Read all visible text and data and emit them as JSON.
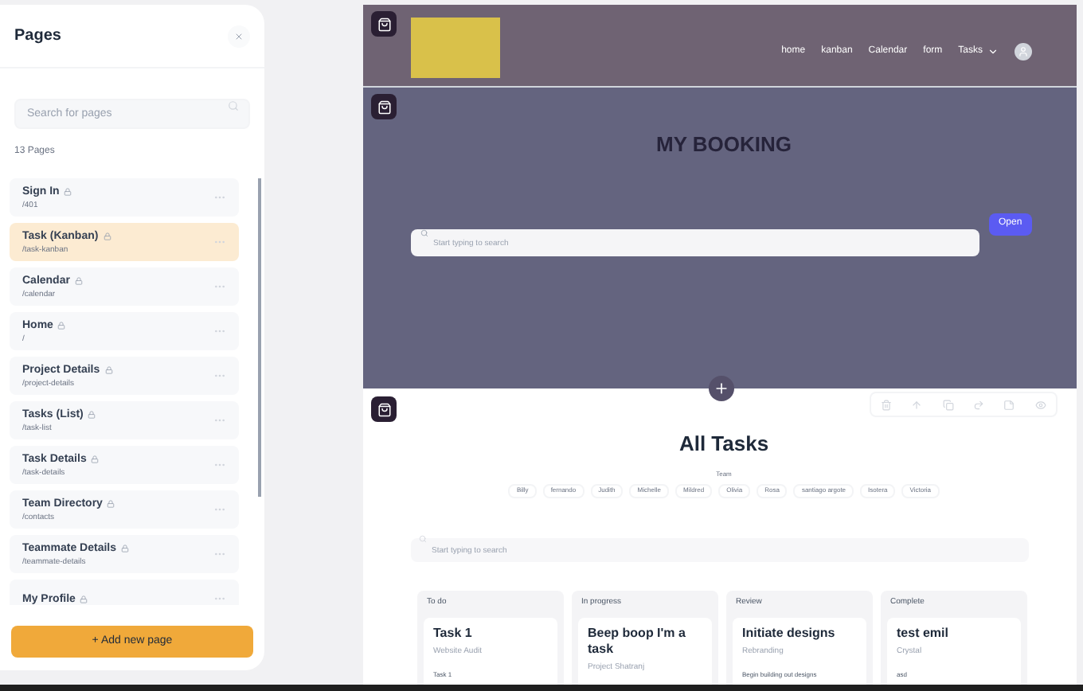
{
  "panel": {
    "title": "Pages",
    "search": {
      "placeholder": "Search for pages"
    },
    "count": "13 Pages",
    "pages": [
      {
        "name": "Sign In",
        "path": "/401",
        "selected": false
      },
      {
        "name": "Task (Kanban)",
        "path": "/task-kanban",
        "selected": true
      },
      {
        "name": "Calendar",
        "path": "/calendar",
        "selected": false
      },
      {
        "name": "Home",
        "path": "/",
        "selected": false
      },
      {
        "name": "Project Details",
        "path": "/project-details",
        "selected": false
      },
      {
        "name": "Tasks (List)",
        "path": "/task-list",
        "selected": false
      },
      {
        "name": "Task Details",
        "path": "/task-details",
        "selected": false
      },
      {
        "name": "Team Directory",
        "path": "/contacts",
        "selected": false
      },
      {
        "name": "Teammate Details",
        "path": "/teammate-details",
        "selected": false
      },
      {
        "name": "My Profile",
        "selected": false
      }
    ],
    "add_button": "+ Add new page"
  },
  "header": {
    "nav": [
      {
        "label": "home",
        "kind": "link"
      },
      {
        "label": "kanban",
        "kind": "link"
      },
      {
        "label": "Calendar",
        "kind": "link"
      },
      {
        "label": "form",
        "kind": "link"
      },
      {
        "label": "Tasks",
        "kind": "dropdown"
      }
    ]
  },
  "booking": {
    "title": "MY BOOKING",
    "search": {
      "placeholder": "Start typing to search"
    },
    "button": "Open"
  },
  "tasks": {
    "title": "All Tasks",
    "team_label": "Team",
    "team": [
      "Billy",
      "fernando",
      "Judith",
      "Michelle",
      "Mildred",
      "Olivia",
      "Rosa",
      "santiago argote",
      "Isotera",
      "Victoria"
    ],
    "search": {
      "placeholder": "Start typing to search"
    },
    "columns": [
      {
        "title": "To do",
        "card": {
          "title": "Task 1",
          "project": "Website Audit",
          "description": "Task 1"
        }
      },
      {
        "title": "In progress",
        "card": {
          "title": "Beep boop I'm a task",
          "project": "Project Shatranj"
        }
      },
      {
        "title": "Review",
        "card": {
          "title": "Initiate designs",
          "project": "Rebranding",
          "description": "Begin building out designs"
        }
      },
      {
        "title": "Complete",
        "card": {
          "title": "test emil",
          "project": "Crystal",
          "description": "asd"
        }
      }
    ]
  }
}
